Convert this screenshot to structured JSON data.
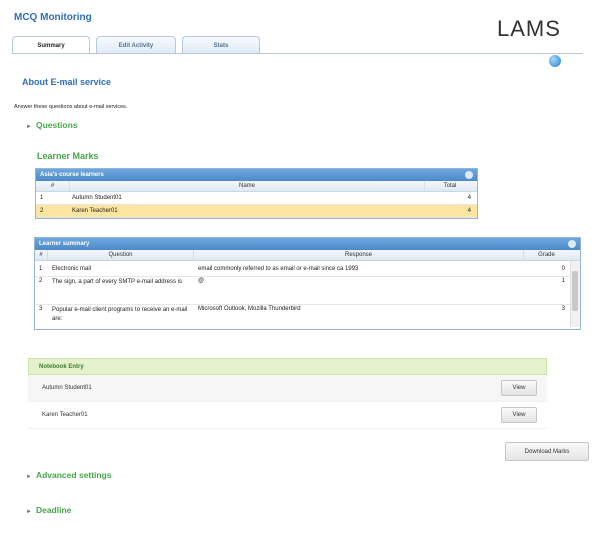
{
  "app": {
    "title": "MCQ Monitoring",
    "logo": "LAMS"
  },
  "tabs": [
    {
      "label": "Summary",
      "active": true
    },
    {
      "label": "Edit Activity",
      "active": false
    },
    {
      "label": "Stats",
      "active": false
    }
  ],
  "activity": {
    "title": "About E-mail service",
    "instructions": "Answer these questions about e-mail services."
  },
  "sections": {
    "questions": "Questions",
    "learner_marks": "Learner Marks",
    "advanced": "Advanced settings",
    "deadline": "Deadline"
  },
  "marks_grid": {
    "caption": "Asia's course learners",
    "columns": [
      "#",
      "Name",
      "Total"
    ],
    "rows": [
      {
        "num": "1",
        "name": "Autumn Student01",
        "total": "4",
        "selected": false
      },
      {
        "num": "2",
        "name": "Karen Teacher01",
        "total": "4",
        "selected": true
      }
    ]
  },
  "summary_grid": {
    "caption": "Learner summary",
    "columns": [
      "#",
      "Question",
      "Response",
      "Grade"
    ],
    "rows": [
      {
        "num": "1",
        "question": "Electronic mail",
        "response": "email commonly referred to as email or e-mail since ca 1993",
        "grade": "0"
      },
      {
        "num": "2",
        "question": "The sign, a part of every SMTP e-mail address is",
        "response": "@",
        "grade": "1"
      },
      {
        "num": "3",
        "question": "Popular e-mail client programs to receive an e-mail are:",
        "response": "Microsoft Outlook, Mozilla Thunderbird",
        "grade": "3"
      }
    ]
  },
  "notebook": {
    "title": "Notebook Entry",
    "rows": [
      {
        "name": "Autumn Student01",
        "action": "View"
      },
      {
        "name": "Karen Teacher01",
        "action": "View"
      }
    ]
  },
  "download_label": "Download Marks",
  "colors": {
    "accent_blue": "#2f6fb7",
    "accent_green": "#46a64a",
    "selected_row": "#fbe59f"
  }
}
